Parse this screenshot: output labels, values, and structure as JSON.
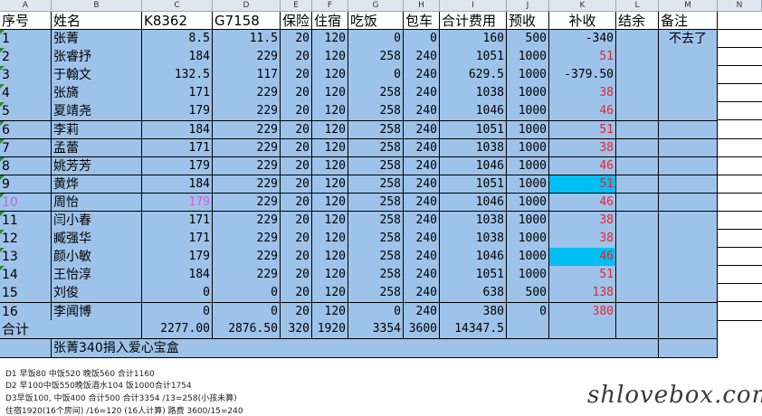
{
  "columns": [
    "A",
    "B",
    "C",
    "D",
    "E",
    "F",
    "G",
    "H",
    "I",
    "J",
    "K",
    "L",
    "M",
    "N"
  ],
  "header": [
    "序号",
    "姓名",
    "K8362",
    "G7158",
    "保险",
    "住宿",
    "吃饭",
    "包车",
    "合计费用",
    "预收",
    "补收",
    "结余",
    "备注"
  ],
  "rows": [
    {
      "no": "1",
      "name": "张菁",
      "k": "8.5",
      "g": "11.5",
      "ins": "20",
      "stay": "120",
      "food": "0",
      "bus": "0",
      "total": "160",
      "pre": "500",
      "add": "-340",
      "bal": "",
      "note": "不去了"
    },
    {
      "no": "2",
      "name": "张睿抒",
      "k": "184",
      "g": "229",
      "ins": "20",
      "stay": "120",
      "food": "258",
      "bus": "240",
      "total": "1051",
      "pre": "1000",
      "add": "51",
      "bal": "",
      "note": ""
    },
    {
      "no": "3",
      "name": "于翰文",
      "k": "132.5",
      "g": "117",
      "ins": "20",
      "stay": "120",
      "food": "0",
      "bus": "240",
      "total": "629.5",
      "pre": "1000",
      "add": "-379.50",
      "bal": "",
      "note": ""
    },
    {
      "no": "4",
      "name": "张旖",
      "k": "171",
      "g": "229",
      "ins": "20",
      "stay": "120",
      "food": "258",
      "bus": "240",
      "total": "1038",
      "pre": "1000",
      "add": "38",
      "bal": "",
      "note": ""
    },
    {
      "no": "5",
      "name": "夏靖尧",
      "k": "179",
      "g": "229",
      "ins": "20",
      "stay": "120",
      "food": "258",
      "bus": "240",
      "total": "1046",
      "pre": "1000",
      "add": "46",
      "bal": "",
      "note": ""
    },
    {
      "no": "6",
      "name": "李莉",
      "k": "184",
      "g": "229",
      "ins": "20",
      "stay": "120",
      "food": "258",
      "bus": "240",
      "total": "1051",
      "pre": "1000",
      "add": "51",
      "bal": "",
      "note": ""
    },
    {
      "no": "7",
      "name": "孟蕾",
      "k": "171",
      "g": "229",
      "ins": "20",
      "stay": "120",
      "food": "258",
      "bus": "240",
      "total": "1038",
      "pre": "1000",
      "add": "38",
      "bal": "",
      "note": ""
    },
    {
      "no": "8",
      "name": "姚芳芳",
      "k": "179",
      "g": "229",
      "ins": "20",
      "stay": "120",
      "food": "258",
      "bus": "240",
      "total": "1046",
      "pre": "1000",
      "add": "46",
      "bal": "",
      "note": ""
    },
    {
      "no": "9",
      "name": "黄烨",
      "k": "184",
      "g": "229",
      "ins": "20",
      "stay": "120",
      "food": "258",
      "bus": "240",
      "total": "1051",
      "pre": "1000",
      "add": "51",
      "bal": "",
      "note": ""
    },
    {
      "no": "10",
      "name": "周怡",
      "k": "179",
      "g": "229",
      "ins": "20",
      "stay": "120",
      "food": "258",
      "bus": "240",
      "total": "1046",
      "pre": "1000",
      "add": "46",
      "bal": "",
      "note": ""
    },
    {
      "no": "11",
      "name": "闫小春",
      "k": "171",
      "g": "229",
      "ins": "20",
      "stay": "120",
      "food": "258",
      "bus": "240",
      "total": "1038",
      "pre": "1000",
      "add": "38",
      "bal": "",
      "note": ""
    },
    {
      "no": "12",
      "name": "臧强华",
      "k": "171",
      "g": "229",
      "ins": "20",
      "stay": "120",
      "food": "258",
      "bus": "240",
      "total": "1038",
      "pre": "1000",
      "add": "38",
      "bal": "",
      "note": ""
    },
    {
      "no": "13",
      "name": "颜小敏",
      "k": "179",
      "g": "229",
      "ins": "20",
      "stay": "120",
      "food": "258",
      "bus": "240",
      "total": "1046",
      "pre": "1000",
      "add": "46",
      "bal": "",
      "note": ""
    },
    {
      "no": "14",
      "name": "王怡淳",
      "k": "184",
      "g": "229",
      "ins": "20",
      "stay": "120",
      "food": "258",
      "bus": "240",
      "total": "1051",
      "pre": "1000",
      "add": "51",
      "bal": "",
      "note": ""
    },
    {
      "no": "15",
      "name": "刘俊",
      "k": "0",
      "g": "0",
      "ins": "20",
      "stay": "120",
      "food": "258",
      "bus": "240",
      "total": "638",
      "pre": "500",
      "add": "138",
      "bal": "",
      "note": ""
    },
    {
      "no": "16",
      "name": "李闻博",
      "k": "0",
      "g": "0",
      "ins": "20",
      "stay": "120",
      "food": "0",
      "bus": "240",
      "total": "380",
      "pre": "0",
      "add": "380",
      "bal": "",
      "note": ""
    }
  ],
  "total_row": {
    "label": "合计",
    "k": "2277.00",
    "g": "2876.50",
    "ins": "320",
    "stay": "1920",
    "food": "3354",
    "bus": "3600",
    "total": "14347.5"
  },
  "donation": "张菁340捐入爱心宝盒",
  "notes": [
    "D1 早饭80 中饭520 晚饭560 合计1160",
    "D2 早100中饭550晚饭酒水104 饭1000合计1754",
    "D3早饭100, 中饭400 合计500 合计3354 /13=258(小孩未算)",
    "住宿1920(16个房间) /16=120  (16人计算)  路费 3600/15=240"
  ],
  "logo": "shlovebox.com",
  "colors": {
    "row_fill": "#9ec3ea",
    "highlight": "#00bff3",
    "red_text": "#e8242c",
    "pink_text": "#d25bd6"
  }
}
